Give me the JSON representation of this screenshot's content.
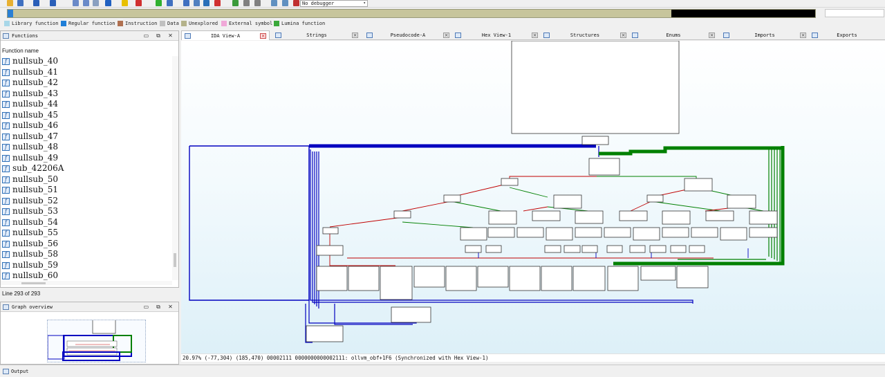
{
  "toolbar": {
    "debugger_select": "No debugger",
    "icons": [
      "open-icon",
      "save-icon",
      "back-icon",
      "forward-icon",
      "jump-icon",
      "search-icon",
      "mark-icon",
      "down-arrow-icon",
      "letter-a-icon",
      "warning-icon",
      "green-circle-icon",
      "graph-icon",
      "function-icon",
      "cross-reference-icon",
      "edit-icon",
      "delete-icon",
      "run-icon",
      "pause-icon",
      "stop-icon",
      "debug-settings-icon",
      "attach-icon",
      "detach-icon"
    ]
  },
  "colors": {
    "library": "#a8d7e8",
    "regular": "#1f7fd8",
    "instruction": "#b07050",
    "data": "#c0c0c0",
    "unexplored": "#b4b28a",
    "external": "#f0a8d8",
    "lumina": "#3aa83a",
    "edge_blue": "#0000c0",
    "edge_green": "#008000",
    "edge_red": "#c00000"
  },
  "legend": [
    {
      "label": "Library function",
      "color": "#a8d7e8"
    },
    {
      "label": "Regular function",
      "color": "#1f7fd8"
    },
    {
      "label": "Instruction",
      "color": "#b07050"
    },
    {
      "label": "Data",
      "color": "#c0c0c0"
    },
    {
      "label": "Unexplored",
      "color": "#b4b28a"
    },
    {
      "label": "External symbol",
      "color": "#f0a8d8"
    },
    {
      "label": "Lumina function",
      "color": "#3aa83a"
    }
  ],
  "functions_panel": {
    "title": "Functions",
    "column": "Function name",
    "items": [
      "nullsub_40",
      "nullsub_41",
      "nullsub_42",
      "nullsub_43",
      "nullsub_44",
      "nullsub_45",
      "nullsub_46",
      "nullsub_47",
      "nullsub_48",
      "nullsub_49",
      "sub_42206A",
      "nullsub_50",
      "nullsub_51",
      "nullsub_52",
      "nullsub_53",
      "nullsub_54",
      "nullsub_55",
      "nullsub_56",
      "nullsub_58",
      "nullsub_59",
      "nullsub_60"
    ],
    "status": "Line 293 of 293"
  },
  "overview_panel": {
    "title": "Graph overview"
  },
  "tabs": [
    {
      "label": "IDA View-A",
      "active": true
    },
    {
      "label": "Strings",
      "active": false
    },
    {
      "label": "Pseudocode-A",
      "active": false
    },
    {
      "label": "Hex View-1",
      "active": false
    },
    {
      "label": "Structures",
      "active": false
    },
    {
      "label": "Enums",
      "active": false
    },
    {
      "label": "Imports",
      "active": false
    },
    {
      "label": "Exports",
      "active": false
    }
  ],
  "graph_status": "20.97% (-77,304) (185,470) 00002111 0000000000002111: ollvm_obf+1F6 (Synchronized with Hex View-1)",
  "output": {
    "label": "Output"
  }
}
